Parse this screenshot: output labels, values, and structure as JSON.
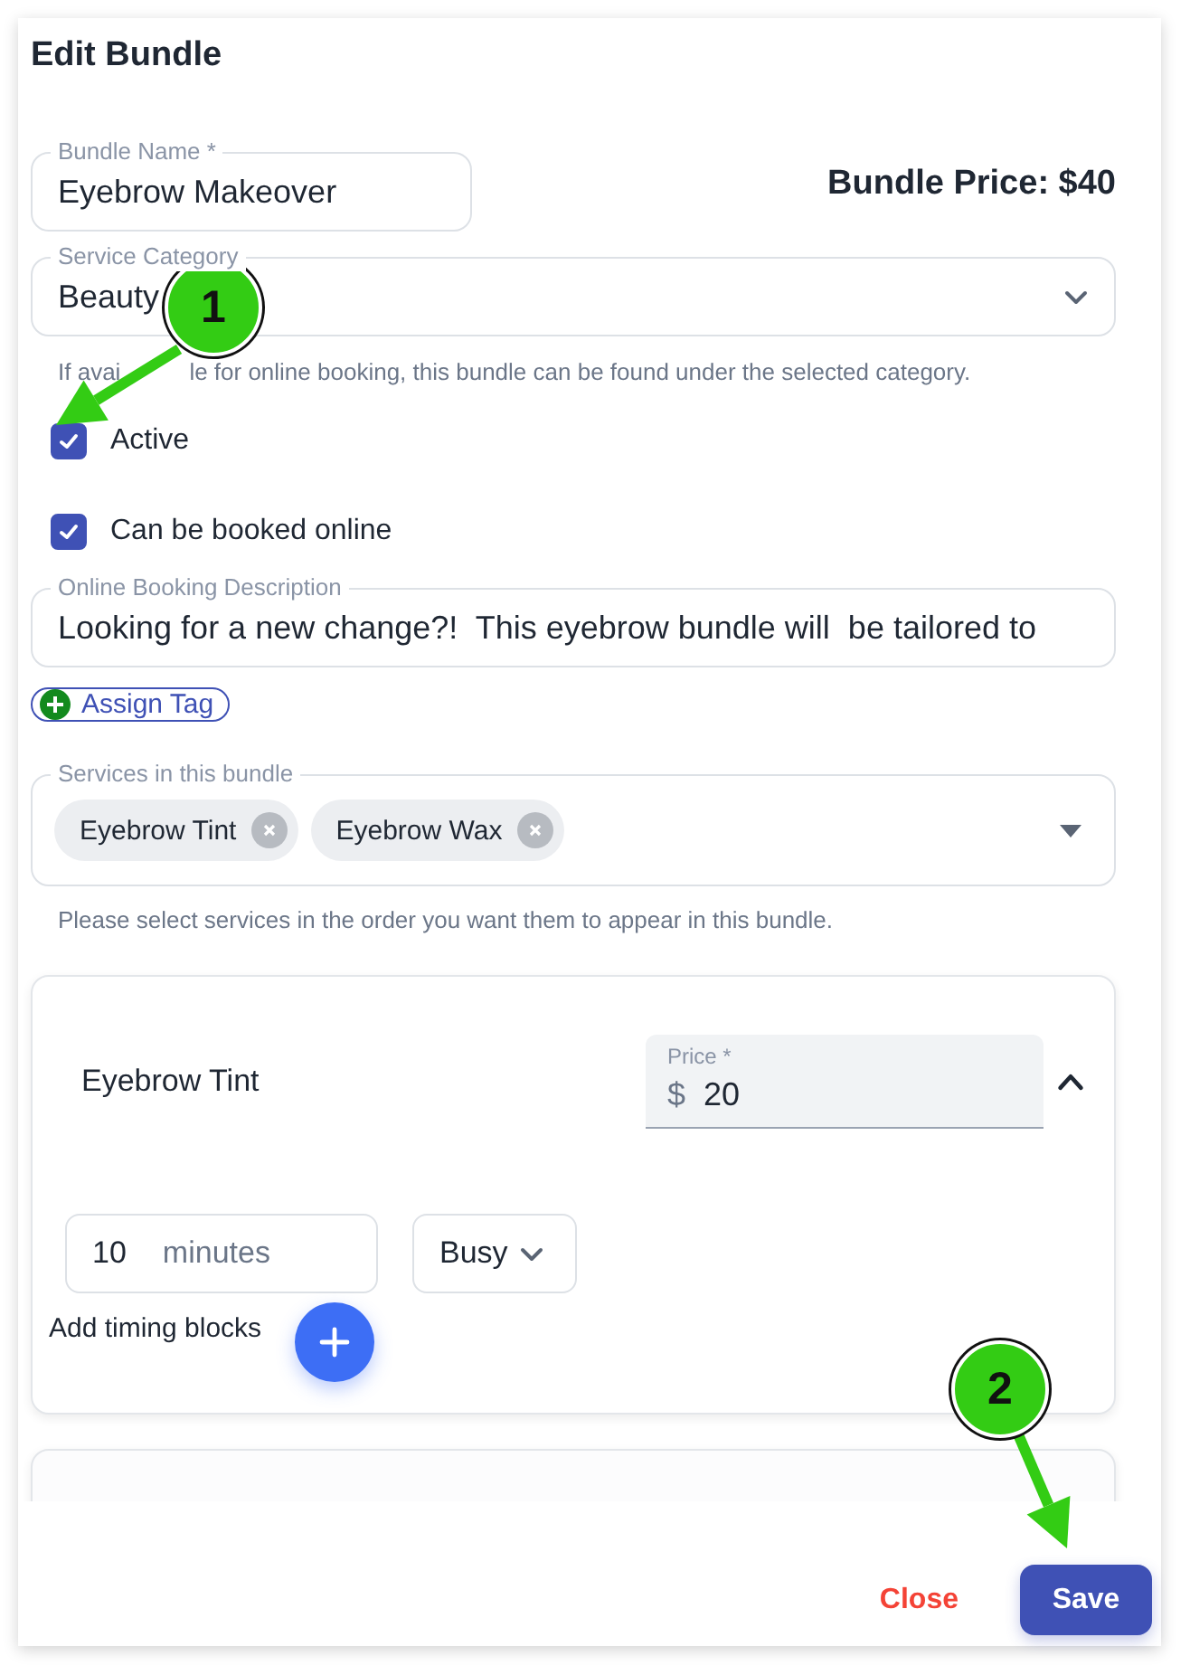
{
  "dialog": {
    "title": "Edit Bundle"
  },
  "bundle_name": {
    "label": "Bundle Name *",
    "value": "Eyebrow Makeover"
  },
  "bundle_price": "Bundle Price: $40",
  "service_category": {
    "label": "Service Category",
    "value": "Beauty",
    "helper_parts": [
      "If avai",
      "le for online booking, this bundle can be found under the selected category."
    ]
  },
  "checkboxes": [
    {
      "label": "Active",
      "checked": true
    },
    {
      "label": "Can be booked online",
      "checked": true
    }
  ],
  "description": {
    "label": "Online Booking Description",
    "value": "Looking for a new change?!  This eyebrow bundle will  be tailored to"
  },
  "assign_tag": "Assign Tag",
  "services": {
    "label": "Services in this bundle",
    "chips": [
      "Eyebrow Tint",
      "Eyebrow Wax"
    ],
    "helper": "Please select services in the order you want them to appear in this bundle."
  },
  "service_cards": [
    {
      "name": "Eyebrow Tint",
      "expanded": true,
      "price_label": "Price *",
      "currency": "$",
      "price": "20",
      "duration": "10",
      "unit": "minutes",
      "status": "Busy",
      "add_label": "Add timing blocks"
    },
    {
      "expanded": false
    }
  ],
  "footer": {
    "buttons": [
      {
        "label": "Close",
        "kind": "text"
      },
      {
        "label": "Save",
        "kind": "primary"
      }
    ]
  },
  "annotations": [
    {
      "label": "1"
    },
    {
      "label": "2"
    }
  ]
}
